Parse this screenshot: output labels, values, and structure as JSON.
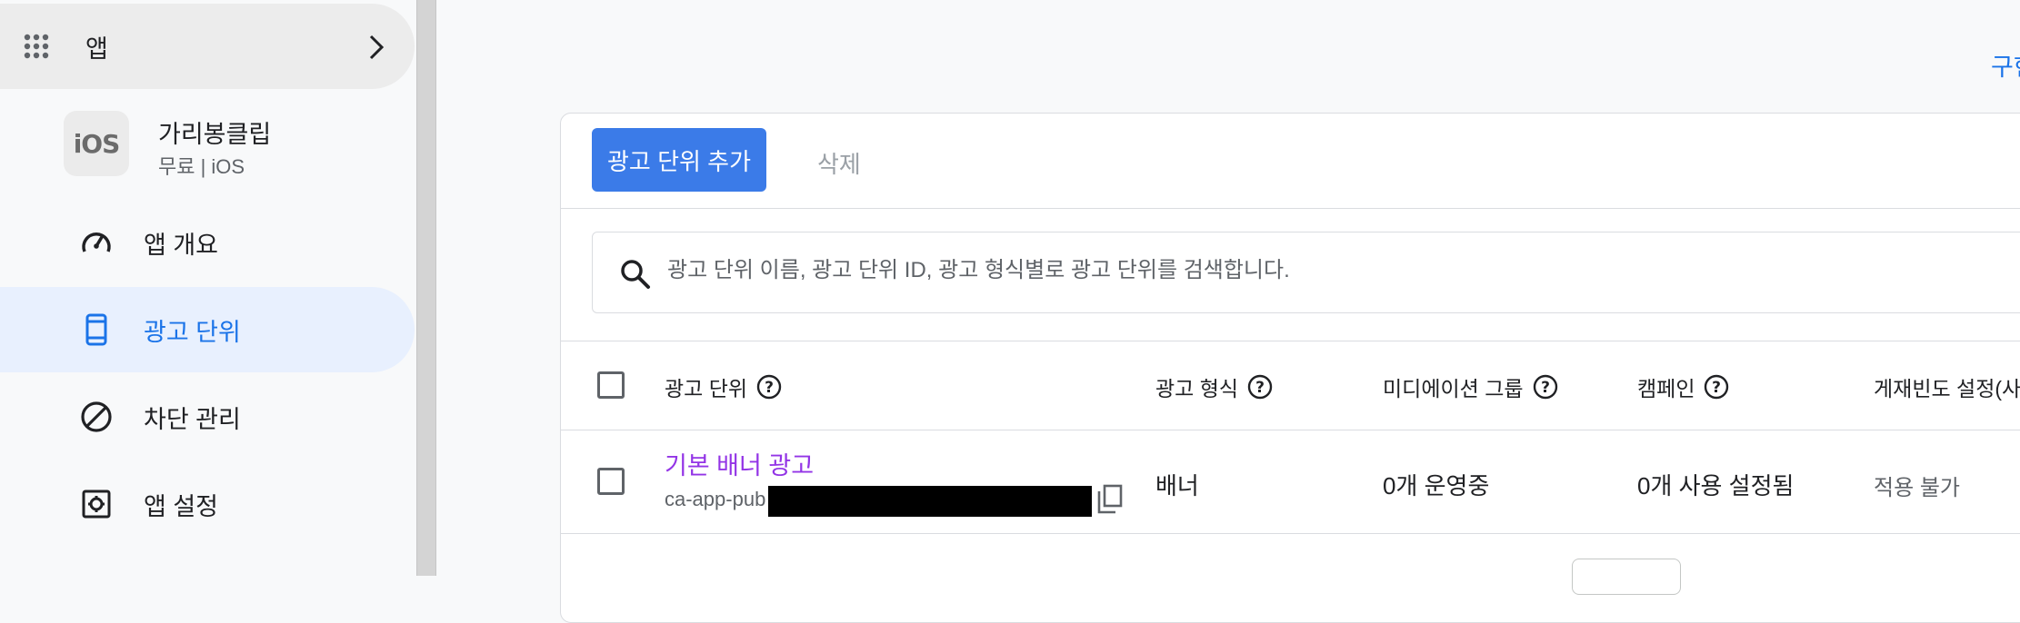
{
  "sidebar": {
    "apps_label": "앱",
    "app": {
      "logo_text": "iOS",
      "name": "가리봉클립",
      "subtitle": "무료 | iOS"
    },
    "items": [
      {
        "label": "앱 개요",
        "icon": "gauge-icon"
      },
      {
        "label": "광고 단위",
        "icon": "phone-icon",
        "active": true
      },
      {
        "label": "차단 관리",
        "icon": "block-icon"
      },
      {
        "label": "앱 설정",
        "icon": "settings-icon"
      }
    ]
  },
  "header": {
    "right_link": "구현"
  },
  "toolbar": {
    "add_label": "광고 단위 추가",
    "delete_label": "삭제"
  },
  "search": {
    "placeholder": "광고 단위 이름, 광고 단위 ID, 광고 형식별로 광고 단위를 검색합니다."
  },
  "table": {
    "columns": [
      "광고 단위",
      "광고 형식",
      "미디에이션 그룹",
      "캠페인",
      "게재빈도 설정(사"
    ],
    "rows": [
      {
        "name": "기본 배너 광고",
        "id_prefix": "ca-app-pub",
        "format": "배너",
        "mediation": "0개 운영중",
        "campaign": "0개 사용 설정됨",
        "frequency": "적용 불가"
      }
    ]
  },
  "colors": {
    "accent": "#1a73e8",
    "button": "#3b7be8",
    "link_visited": "#9334e6",
    "active_bg": "#e8f0fe"
  }
}
